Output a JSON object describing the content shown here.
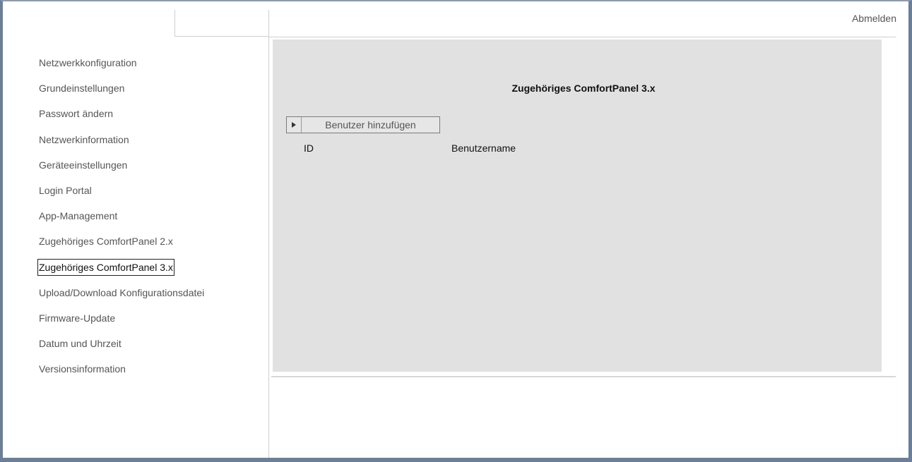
{
  "header": {
    "logout_label": "Abmelden"
  },
  "sidebar": {
    "items": [
      {
        "label": "Netzwerkkonfiguration"
      },
      {
        "label": "Grundeinstellungen"
      },
      {
        "label": "Passwort ändern"
      },
      {
        "label": "Netzwerkinformation"
      },
      {
        "label": "Geräteeinstellungen"
      },
      {
        "label": "Login Portal"
      },
      {
        "label": "App-Management"
      },
      {
        "label": "Zugehöriges ComfortPanel 2.x"
      },
      {
        "label": "Zugehöriges ComfortPanel 3.x",
        "active": true
      },
      {
        "label": "Upload/Download Konfigurationsdatei"
      },
      {
        "label": "Firmware-Update"
      },
      {
        "label": "Datum und Uhrzeit"
      },
      {
        "label": "Versionsinformation"
      }
    ]
  },
  "main": {
    "title": "Zugehöriges ComfortPanel 3.x",
    "add_user_label": "Benutzer hinzufügen",
    "add_user_icon": "play-arrow-icon",
    "columns": [
      "ID",
      "Benutzername"
    ]
  },
  "colors": {
    "panel_background": "#e1e1e1",
    "window_border": "#6b7f99"
  }
}
